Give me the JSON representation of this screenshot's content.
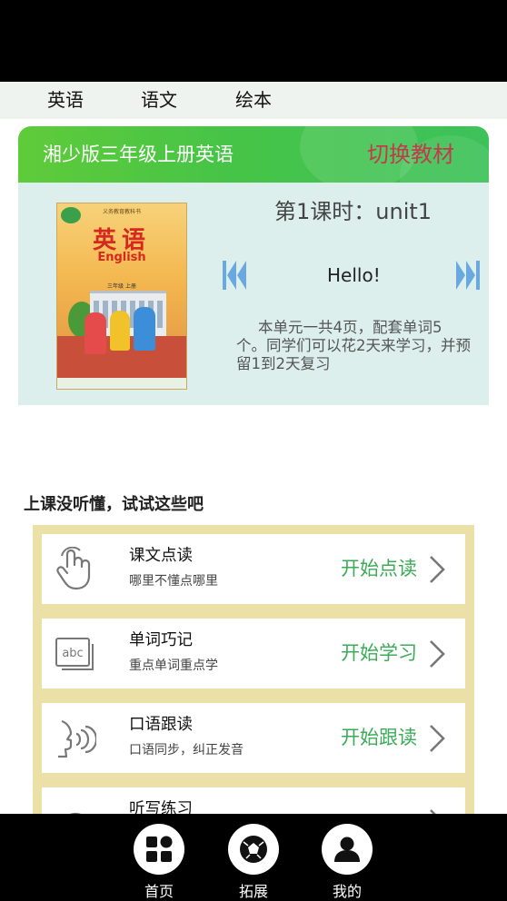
{
  "tabs": [
    {
      "label": "英语"
    },
    {
      "label": "语文"
    },
    {
      "label": "绘本"
    }
  ],
  "textbook": {
    "title": "湘少版三年级上册英语",
    "switch_label": "切换教材",
    "cover": {
      "publisher_line": "义务教育教科书",
      "title_cn": "英语",
      "title_en": "English",
      "grade_line": "三年级 上册"
    }
  },
  "lesson": {
    "heading": "第1课时：unit1",
    "name": "Hello!",
    "description": "本单元一共4页，配套单词5个。同学们可以花2天来学习，并预留1到2天复习"
  },
  "section_title": "上课没听懂，试试这些吧",
  "activities": [
    {
      "title": "课文点读",
      "subtitle": "哪里不懂点哪里",
      "action": "开始点读",
      "icon": "hand-pointer-icon"
    },
    {
      "title": "单词巧记",
      "subtitle": "重点单词重点学",
      "action": "开始学习",
      "icon": "abc-card-icon"
    },
    {
      "title": "口语跟读",
      "subtitle": "口语同步，纠正发音",
      "action": "开始跟读",
      "icon": "speaking-head-icon"
    },
    {
      "title": "听写练习",
      "subtitle": "",
      "action": "",
      "icon": "headphones-icon"
    }
  ],
  "bottom_nav": [
    {
      "label": "首页",
      "icon": "grid-icon"
    },
    {
      "label": "拓展",
      "icon": "ball-icon"
    },
    {
      "label": "我的",
      "icon": "user-icon"
    }
  ],
  "colors": {
    "header_green": "#46c447",
    "switch_red": "#c23b4a",
    "card_bg": "#dcefec",
    "frame_yellow": "#ebe0a6",
    "action_green": "#3cab58",
    "arrow_blue": "#6aa8e0"
  }
}
